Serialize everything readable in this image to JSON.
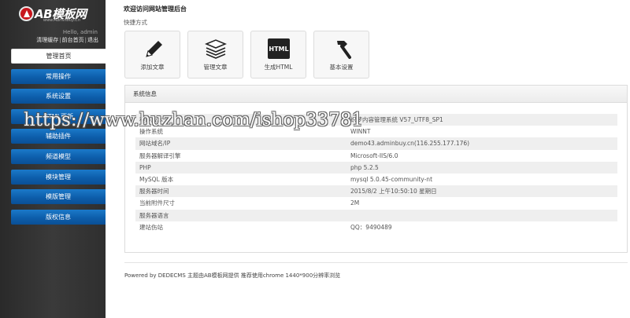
{
  "sidebar": {
    "logo_text": "AB模板网",
    "logo_sub": "www.AdminBuy.Cn",
    "hello": "Hello, admin",
    "links": [
      "清理缓存",
      "前台首页",
      "退出"
    ],
    "items": [
      {
        "label": "管理首页",
        "active": true
      },
      {
        "label": "常用操作"
      },
      {
        "label": "系统设置"
      },
      {
        "label": "HTML更新"
      },
      {
        "label": "辅助插件"
      },
      {
        "label": "频道模型"
      },
      {
        "label": "模块管理"
      },
      {
        "label": "模版管理"
      },
      {
        "label": "版权信息"
      }
    ]
  },
  "main": {
    "title": "欢迎访问网站管理后台",
    "quick_label": "快捷方式",
    "tiles": [
      {
        "label": "添加文章",
        "icon": "pencil-icon"
      },
      {
        "label": "管理文章",
        "icon": "stack-icon"
      },
      {
        "label": "生成HTML",
        "icon": "html-icon",
        "icon_text": "HTML"
      },
      {
        "label": "基本设置",
        "icon": "hammer-icon"
      }
    ],
    "panel_title": "系统信息",
    "info": [
      {
        "k": "程序版本",
        "v": "织梦内容管理系统 V57_UTF8_SP1"
      },
      {
        "k": "操作系统",
        "v": "WINNT"
      },
      {
        "k": "网站域名/IP",
        "v": "demo43.adminbuy.cn(116.255.177.176)"
      },
      {
        "k": "服务器解译引擎",
        "v": "Microsoft-IIS/6.0"
      },
      {
        "k": "PHP",
        "v": "php 5.2.5"
      },
      {
        "k": "MySQL 版本",
        "v": "mysql 5.0.45-community-nt"
      },
      {
        "k": "服务器时间",
        "v": "2015/8/2 上午10:50:10 星期日"
      },
      {
        "k": "当前附件尺寸",
        "v": "2M"
      },
      {
        "k": "服务器语言",
        "v": ""
      },
      {
        "k": "建站伤站",
        "v": "QQ：9490489"
      }
    ],
    "footer": "Powered by DEDECMS 主题由AB模板网提供 推荐使用chrome 1440*900分辨率浏览"
  },
  "watermark": "https://www.huzhan.com/ishop33781",
  "colors": {
    "nav_blue": "#0d5eab",
    "sidebar_bg": "#333333",
    "logo_red": "#c8161d"
  }
}
